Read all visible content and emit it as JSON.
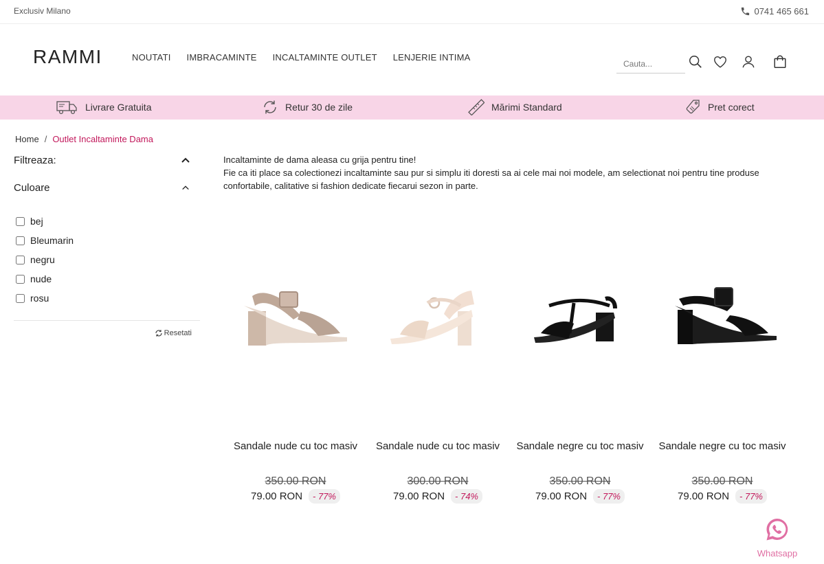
{
  "topbar": {
    "store": "Exclusiv Milano",
    "phone": "0741 465 661"
  },
  "header": {
    "logo": "RAMMI",
    "nav": [
      "NOUTATI",
      "IMBRACAMINTE",
      "INCALTAMINTE OUTLET",
      "LENJERIE INTIMA"
    ],
    "search_placeholder": "Cauta..."
  },
  "benefits": [
    {
      "label": "Livrare Gratuita",
      "icon": "truck-icon"
    },
    {
      "label": "Retur 30 de zile",
      "icon": "refresh-icon"
    },
    {
      "label": "Mărimi Standard",
      "icon": "ruler-icon"
    },
    {
      "label": "Pret corect",
      "icon": "price-tag-icon"
    }
  ],
  "breadcrumb": {
    "home": "Home",
    "separator": "/",
    "current": "Outlet Incaltaminte Dama"
  },
  "filters": {
    "title": "Filtreaza:",
    "color_title": "Culoare",
    "colors": [
      "bej",
      "Bleumarin",
      "negru",
      "nude",
      "rosu"
    ],
    "reset": "Resetati"
  },
  "intro": {
    "line1": "Incaltaminte de dama aleasa cu grija pentru tine!",
    "line2": "Fie ca iti place sa colectionezi incaltaminte sau pur si simplu iti doresti sa ai cele mai noi modele, am selectionat noi pentru tine produse confortabile, calitative si fashion dedicate fiecarui sezon in parte."
  },
  "products": [
    {
      "name": "Sandale nude cu toc masiv",
      "old_price": "350.00 RON",
      "price": "79.00 RON",
      "discount": "- 77%",
      "shoe_color": "#c9b4a6"
    },
    {
      "name": "Sandale nude cu toc masiv",
      "old_price": "300.00 RON",
      "price": "79.00 RON",
      "discount": "- 74%",
      "shoe_color": "#f0dccd"
    },
    {
      "name": "Sandale negre cu toc masiv",
      "old_price": "350.00 RON",
      "price": "79.00 RON",
      "discount": "- 77%",
      "shoe_color": "#1a1a1a"
    },
    {
      "name": "Sandale negre cu toc masiv",
      "old_price": "350.00 RON",
      "price": "79.00 RON",
      "discount": "- 77%",
      "shoe_color": "#111111"
    }
  ],
  "whatsapp": {
    "label": "Whatsapp"
  },
  "colors": {
    "accent": "#c2185b",
    "benefit_bar": "#f8d5e7",
    "whatsapp": "#e06fa3"
  }
}
